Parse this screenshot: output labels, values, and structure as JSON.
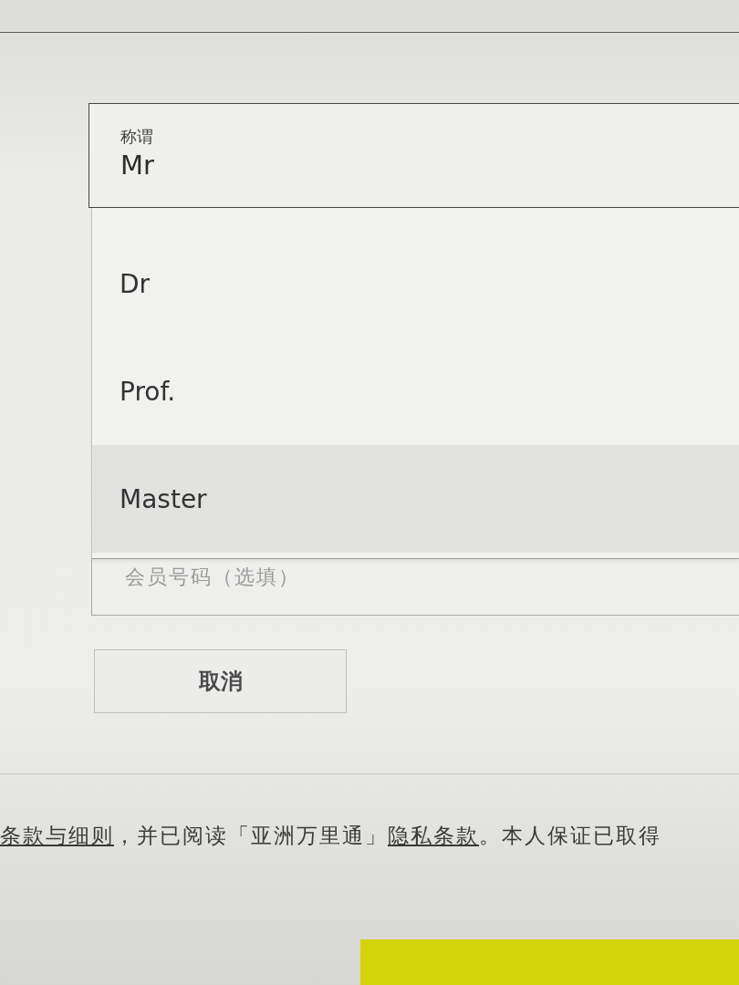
{
  "title_field": {
    "label": "称谓",
    "value": "Mr",
    "expanded": true
  },
  "title_options": [
    {
      "label": "Dr",
      "selected": false
    },
    {
      "label": "Prof.",
      "selected": false
    },
    {
      "label": "Master",
      "selected": true
    }
  ],
  "membership_field": {
    "placeholder": "会员号码（选填）"
  },
  "cancel_button": "取消",
  "consent_text": [
    {
      "kind": "link",
      "text": "条款与细则"
    },
    {
      "kind": "text",
      "text": "，并已阅读「亚洲万里通」"
    },
    {
      "kind": "link",
      "text": "隐私条款"
    },
    {
      "kind": "text",
      "text": "。本人保证已取得"
    }
  ]
}
